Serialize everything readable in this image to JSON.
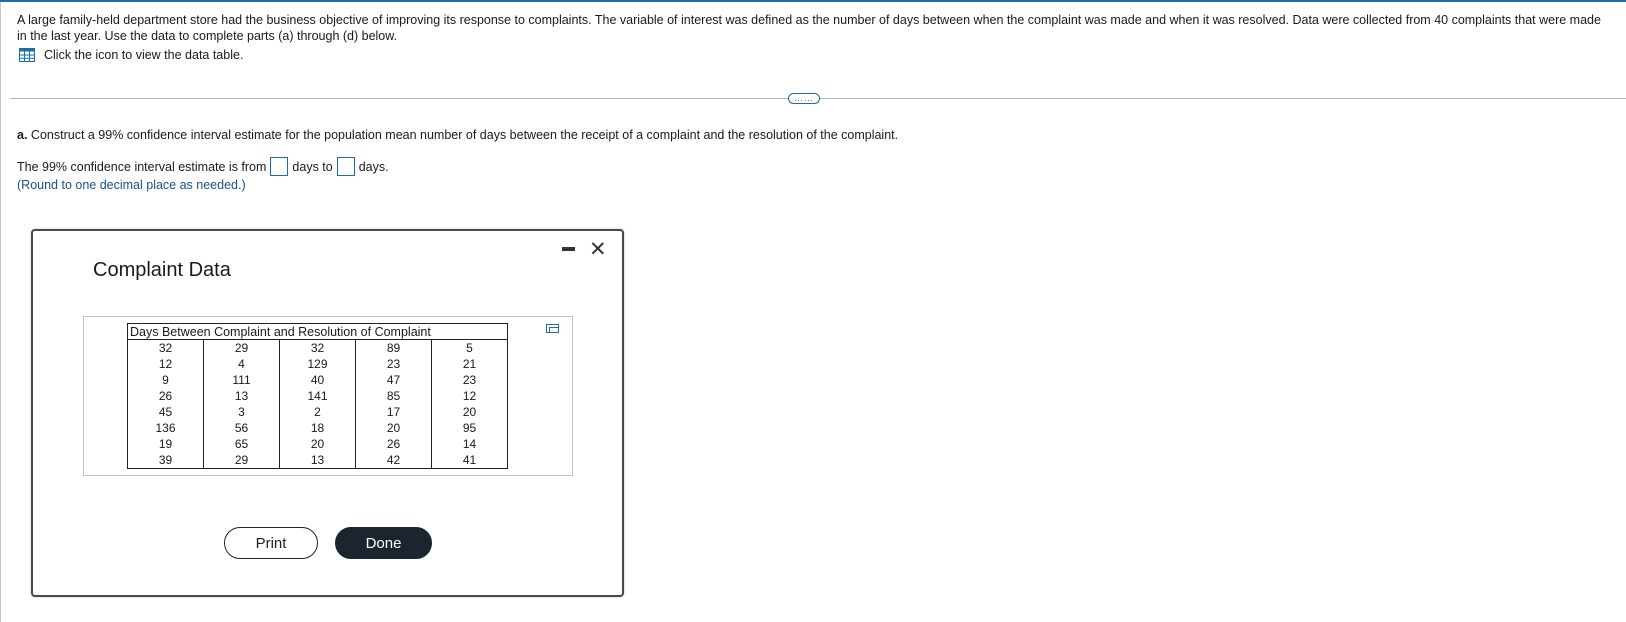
{
  "problem": {
    "text": "A large family-held department store had the business objective of improving its response to complaints. The variable of interest was defined as the number of days between when the complaint was made and when it was resolved. Data were collected from 40 complaints that were made in the last year. Use the data to complete parts (a) through (d) below."
  },
  "data_link": {
    "icon": "table-grid-icon",
    "label": "Click the icon to view the data table."
  },
  "divider": {
    "more_label": "……"
  },
  "question": {
    "part_label": "a.",
    "text": "Construct a 99% confidence interval estimate for the population mean number of days between the receipt of a complaint and the resolution of the complaint.",
    "answer_prefix": "The 99% confidence interval estimate is from",
    "answer_middle": "days to",
    "answer_suffix": "days.",
    "answer_low": "",
    "answer_high": "",
    "hint": "(Round to one decimal place as needed.)"
  },
  "dialog": {
    "title": "Complaint Data",
    "minimize_icon": "minimize-icon",
    "close_icon": "close-icon",
    "table": {
      "header": "Days Between Complaint and Resolution of Complaint",
      "rows": [
        [
          "32",
          "29",
          "32",
          "89",
          "5"
        ],
        [
          "12",
          "4",
          "129",
          "23",
          "21"
        ],
        [
          "9",
          "111",
          "40",
          "47",
          "23"
        ],
        [
          "26",
          "13",
          "141",
          "85",
          "12"
        ],
        [
          "45",
          "3",
          "2",
          "17",
          "20"
        ],
        [
          "136",
          "56",
          "18",
          "20",
          "95"
        ],
        [
          "19",
          "65",
          "20",
          "26",
          "14"
        ],
        [
          "39",
          "29",
          "13",
          "42",
          "41"
        ]
      ]
    },
    "copy_icon": "copy-icon",
    "print_label": "Print",
    "done_label": "Done"
  }
}
